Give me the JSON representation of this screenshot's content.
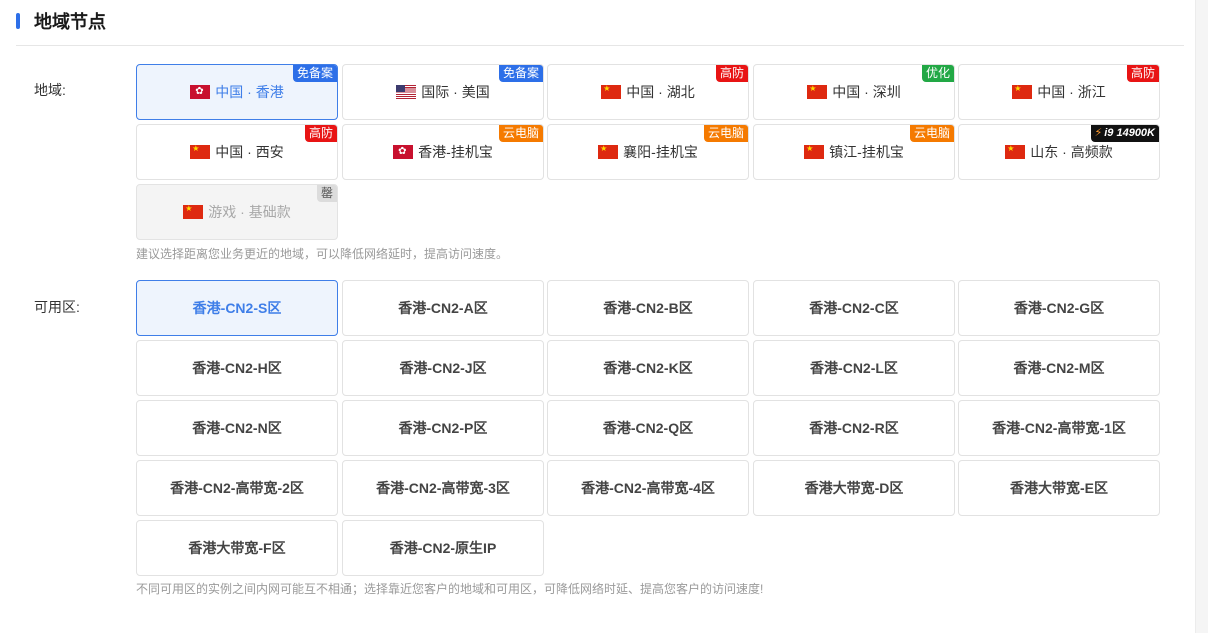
{
  "section": {
    "title": "地域节点"
  },
  "region": {
    "label": "地域:",
    "hint": "建议选择距离您业务更近的地域，可以降低网络延时，提高访问速度。",
    "items": [
      {
        "name": "中国 · 香港",
        "flag": "hk",
        "badge": "免备案",
        "badge_color": "#2d6fe8",
        "state": "active"
      },
      {
        "name": "国际 · 美国",
        "flag": "us",
        "badge": "免备案",
        "badge_color": "#2d6fe8",
        "state": "normal"
      },
      {
        "name": "中国 · 湖北",
        "flag": "cn",
        "badge": "高防",
        "badge_color": "#e81414",
        "state": "normal"
      },
      {
        "name": "中国 · 深圳",
        "flag": "cn",
        "badge": "优化",
        "badge_color": "#22a845",
        "state": "normal"
      },
      {
        "name": "中国 · 浙江",
        "flag": "cn",
        "badge": "高防",
        "badge_color": "#e81414",
        "state": "normal"
      },
      {
        "name": "中国 · 西安",
        "flag": "cn",
        "badge": "高防",
        "badge_color": "#e81414",
        "state": "normal"
      },
      {
        "name": "香港-挂机宝",
        "flag": "hk",
        "badge": "云电脑",
        "badge_color": "#f57a00",
        "state": "normal"
      },
      {
        "name": "襄阳-挂机宝",
        "flag": "cn",
        "badge": "云电脑",
        "badge_color": "#f57a00",
        "state": "normal"
      },
      {
        "name": "镇江-挂机宝",
        "flag": "cn",
        "badge": "云电脑",
        "badge_color": "#f57a00",
        "state": "normal"
      },
      {
        "name": "山东 · 高频款",
        "flag": "cn",
        "badge": "i9 14900K",
        "badge_color": "#111111",
        "badge_icon": "lightning-icon",
        "state": "normal"
      },
      {
        "name": "游戏 · 基础款",
        "flag": "cn",
        "badge": "罄",
        "badge_color": "#dcdcdc",
        "state": "disabled"
      }
    ]
  },
  "zone": {
    "label": "可用区:",
    "hint": "不同可用区的实例之间内网可能互不相通；选择靠近您客户的地域和可用区，可降低网络时延、提高您客户的访问速度!",
    "items": [
      {
        "name": "香港-CN2-S区",
        "state": "active"
      },
      {
        "name": "香港-CN2-A区",
        "state": "normal"
      },
      {
        "name": "香港-CN2-B区",
        "state": "normal"
      },
      {
        "name": "香港-CN2-C区",
        "state": "normal"
      },
      {
        "name": "香港-CN2-G区",
        "state": "normal"
      },
      {
        "name": "香港-CN2-H区",
        "state": "normal"
      },
      {
        "name": "香港-CN2-J区",
        "state": "normal"
      },
      {
        "name": "香港-CN2-K区",
        "state": "normal"
      },
      {
        "name": "香港-CN2-L区",
        "state": "normal"
      },
      {
        "name": "香港-CN2-M区",
        "state": "normal"
      },
      {
        "name": "香港-CN2-N区",
        "state": "normal"
      },
      {
        "name": "香港-CN2-P区",
        "state": "normal"
      },
      {
        "name": "香港-CN2-Q区",
        "state": "normal"
      },
      {
        "name": "香港-CN2-R区",
        "state": "normal"
      },
      {
        "name": "香港-CN2-高带宽-1区",
        "state": "normal"
      },
      {
        "name": "香港-CN2-高带宽-2区",
        "state": "normal"
      },
      {
        "name": "香港-CN2-高带宽-3区",
        "state": "normal"
      },
      {
        "name": "香港-CN2-高带宽-4区",
        "state": "normal"
      },
      {
        "name": "香港大带宽-D区",
        "state": "normal"
      },
      {
        "name": "香港大带宽-E区",
        "state": "normal"
      },
      {
        "name": "香港大带宽-F区",
        "state": "normal"
      },
      {
        "name": "香港-CN2-原生IP",
        "state": "normal"
      }
    ]
  }
}
